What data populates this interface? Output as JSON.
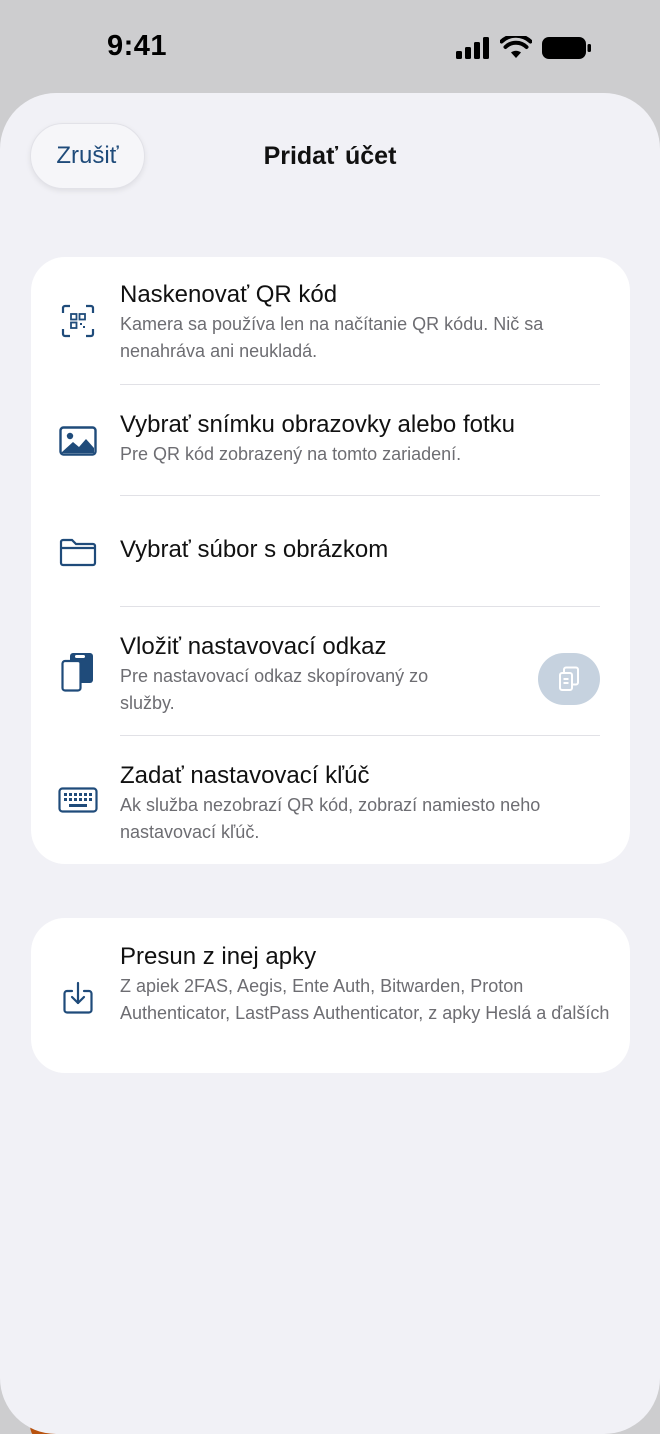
{
  "status_bar": {
    "time": "9:41"
  },
  "header": {
    "cancel_label": "Zrušiť",
    "title": "Pridať účet"
  },
  "options": [
    {
      "title": "Naskenovať QR kód",
      "description": "Kamera sa používa len na načítanie QR kódu. Nič sa nenahráva ani neukladá.",
      "icon": "qr-scan-icon"
    },
    {
      "title": "Vybrať snímku obrazovky alebo fotku",
      "description": "Pre QR kód zobrazený na tomto zariadení.",
      "icon": "photo-icon"
    },
    {
      "title": "Vybrať súbor s obrázkom",
      "description": "",
      "icon": "folder-icon"
    },
    {
      "title": "Vložiť nastavovací odkaz",
      "description": "Pre nastavovací odkaz skopírovaný zo služby.",
      "icon": "paste-link-icon"
    },
    {
      "title": "Zadať nastavovací kľúč",
      "description": "Ak služba nezobrazí QR kód, zobrazí namiesto neho nastavovací kľúč.",
      "icon": "keyboard-icon"
    }
  ],
  "migrate": {
    "title": "Presun z inej apky",
    "description": "Z apiek 2FAS, Aegis, Ente Auth, Bitwarden, Proton Authenticator, LastPass Authenticator, z apky Heslá a ďalších",
    "icon": "import-icon"
  },
  "colors": {
    "accent": "#1f4b7a",
    "sheet_bg": "#f1f1f6",
    "card_bg": "#ffffff",
    "paste_button_bg": "#c6d2df"
  }
}
